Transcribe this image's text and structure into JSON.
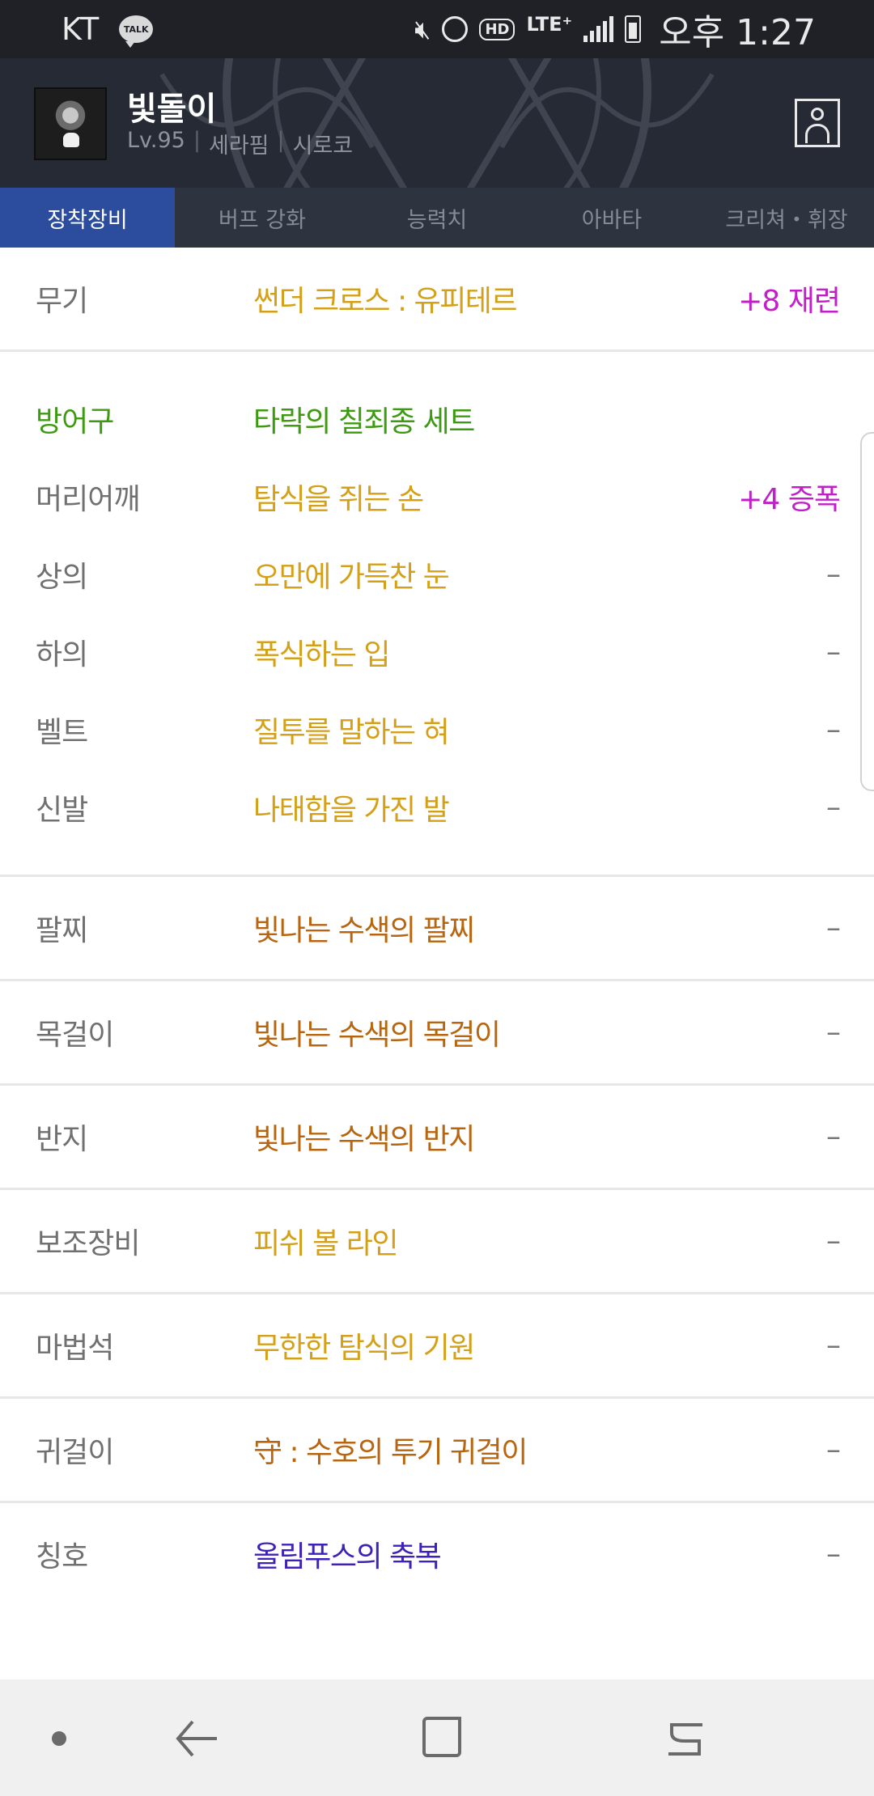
{
  "status_bar": {
    "carrier": "KT",
    "talk_badge": "TALK",
    "hd": "HD",
    "lte": "LTE⁺",
    "time": "오후 1:27",
    "icons": [
      "kakaotalk-icon",
      "mute-icon",
      "alarm-icon",
      "hd-icon",
      "lte-icon",
      "signal-icon",
      "battery-icon"
    ]
  },
  "header": {
    "name": "빛돌이",
    "level": "Lv.95",
    "job": "세라핌",
    "server": "시로코",
    "separator": "|"
  },
  "tabs": [
    {
      "label": "장착장비",
      "active": true
    },
    {
      "label": "버프 강화",
      "active": false
    },
    {
      "label": "능력치",
      "active": false
    },
    {
      "label": "아바타",
      "active": false
    },
    {
      "label": "크리쳐・휘장",
      "active": false
    }
  ],
  "equipment": {
    "weapon": {
      "slot": "무기",
      "item": "썬더 크로스 : 유피테르",
      "enhance": "+8 재련"
    },
    "armor": {
      "set_slot": "방어구",
      "set_name": "타락의 칠죄종 세트",
      "items": [
        {
          "slot": "머리어깨",
          "item": "탐식을 쥐는 손",
          "enhance": "+4 증폭"
        },
        {
          "slot": "상의",
          "item": "오만에 가득찬 눈",
          "enhance": "–"
        },
        {
          "slot": "하의",
          "item": "폭식하는 입",
          "enhance": "–"
        },
        {
          "slot": "벨트",
          "item": "질투를 말하는 혀",
          "enhance": "–"
        },
        {
          "slot": "신발",
          "item": "나태함을 가진 발",
          "enhance": "–"
        }
      ]
    },
    "others": [
      {
        "slot": "팔찌",
        "item": "빛나는 수색의 팔찌",
        "enhance": "–"
      },
      {
        "slot": "목걸이",
        "item": "빛나는 수색의 목걸이",
        "enhance": "–"
      },
      {
        "slot": "반지",
        "item": "빛나는 수색의 반지",
        "enhance": "–"
      },
      {
        "slot": "보조장비",
        "item": "피쉬 볼 라인",
        "enhance": "–"
      },
      {
        "slot": "마법석",
        "item": "무한한 탐식의 기원",
        "enhance": "–"
      },
      {
        "slot": "귀걸이",
        "item": "守 : 수호의 투기 귀걸이",
        "enhance": "–"
      },
      {
        "slot": "칭호",
        "item": "올림푸스의 축복",
        "enhance": "–"
      }
    ]
  },
  "colors": {
    "epic": "#d4a017",
    "legendary_orange": "#b8650f",
    "set_green": "#3e9a12",
    "enhance_magenta": "#c21fc9",
    "title_purple": "#3d21b8",
    "slot_gray": "#707070"
  }
}
